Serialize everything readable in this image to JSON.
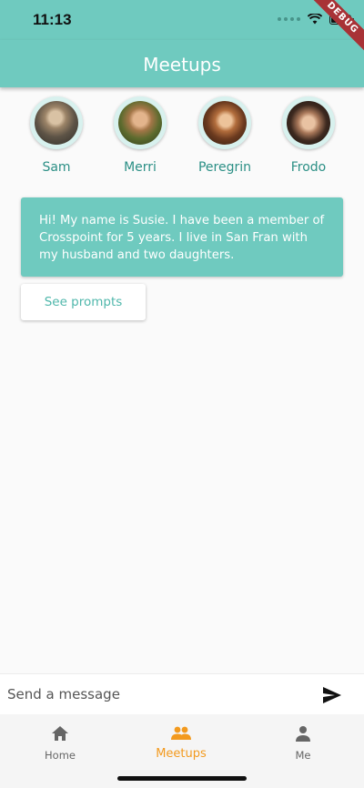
{
  "status_bar": {
    "time": "11:13"
  },
  "debug_banner": "DEBUG",
  "app_bar": {
    "title": "Meetups"
  },
  "members": [
    {
      "name": "Sam"
    },
    {
      "name": "Merri"
    },
    {
      "name": "Peregrin"
    },
    {
      "name": "Frodo"
    }
  ],
  "intro_message": "Hi!  My name is Susie.  I have been a member of Crosspoint for 5 years.  I live in San Fran with my husband and two daughters.",
  "prompts_button": "See prompts",
  "composer": {
    "placeholder": "Send a message"
  },
  "bottom_nav": {
    "items": [
      {
        "label": "Home",
        "icon": "home-icon"
      },
      {
        "label": "Meetups",
        "icon": "people-icon"
      },
      {
        "label": "Me",
        "icon": "person-icon"
      }
    ],
    "active": "Meetups"
  },
  "colors": {
    "primary": "#6fcabf",
    "accent": "#f39a1e",
    "name_text": "#2b8f85"
  }
}
